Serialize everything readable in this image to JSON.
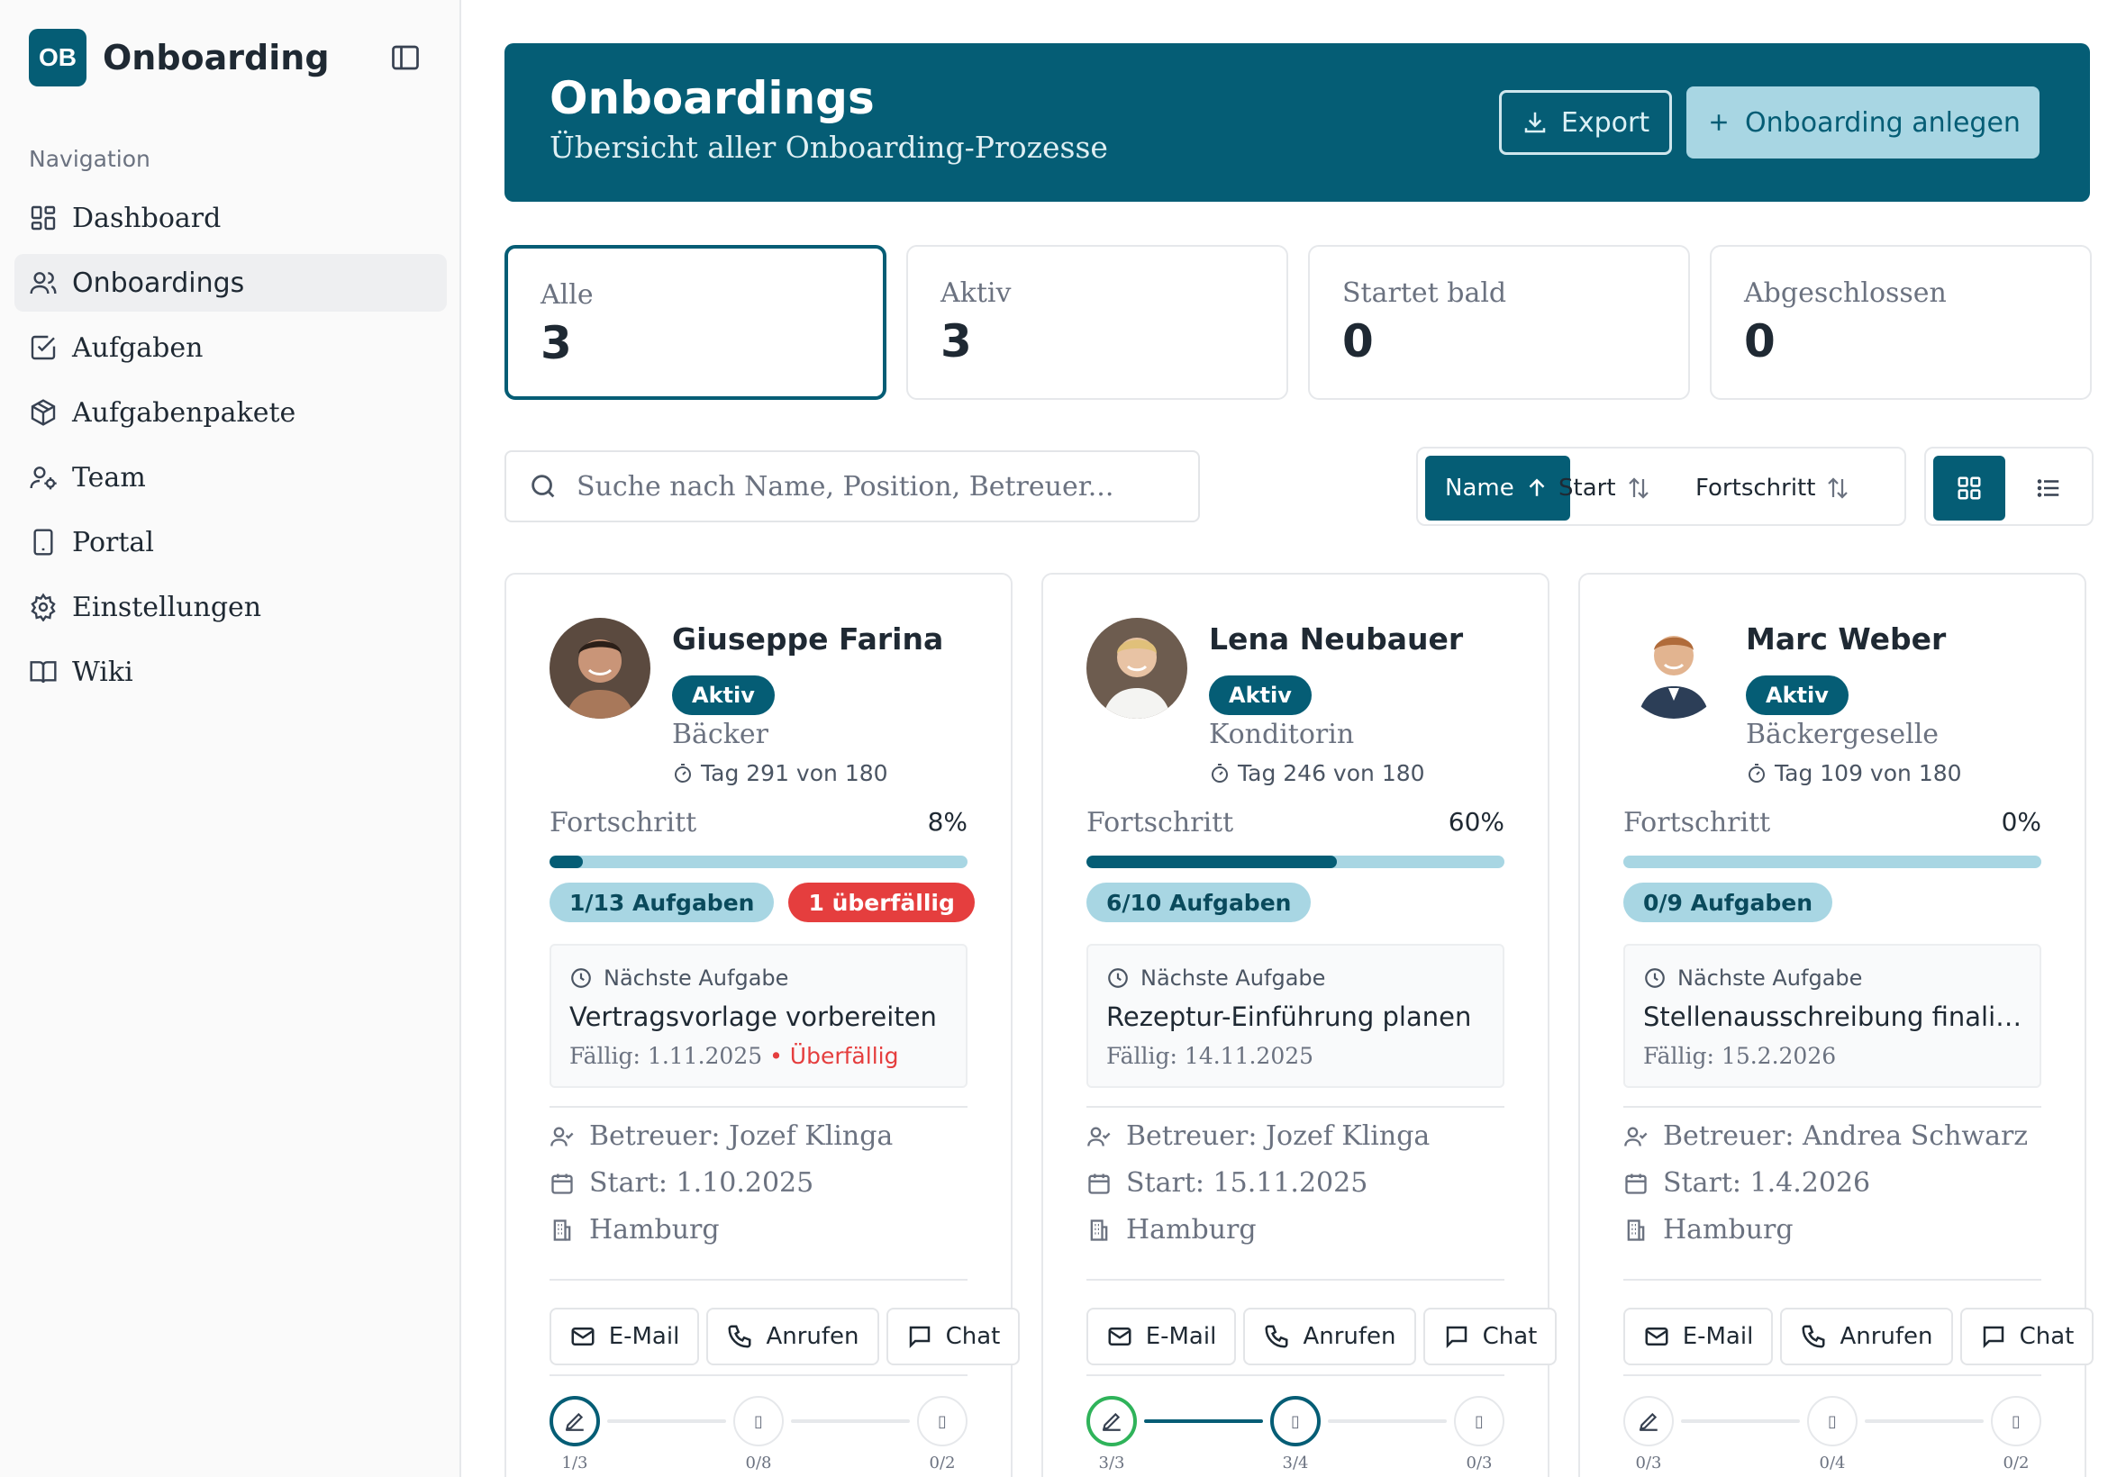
{
  "app": {
    "logo": "OB",
    "name": "Onboarding",
    "toggle_icon": "sidebar-toggle-icon"
  },
  "nav": {
    "caption": "Navigation",
    "items": [
      {
        "label": "Dashboard",
        "icon": "dashboard-icon"
      },
      {
        "label": "Onboardings",
        "icon": "users-icon"
      },
      {
        "label": "Aufgaben",
        "icon": "checkbox-icon"
      },
      {
        "label": "Aufgabenpakete",
        "icon": "package-icon"
      },
      {
        "label": "Team",
        "icon": "team-icon"
      },
      {
        "label": "Portal",
        "icon": "tablet-icon"
      },
      {
        "label": "Einstellungen",
        "icon": "gear-icon"
      },
      {
        "label": "Wiki",
        "icon": "book-icon"
      }
    ],
    "active": "Onboardings"
  },
  "header": {
    "title": "Onboardings",
    "subtitle": "Übersicht aller Onboarding-Prozesse",
    "export_label": "Export",
    "new_label": "Onboarding anlegen"
  },
  "stats": [
    {
      "label": "Alle",
      "value": "3"
    },
    {
      "label": "Aktiv",
      "value": "3"
    },
    {
      "label": "Startet bald",
      "value": "0"
    },
    {
      "label": "Abgeschlossen",
      "value": "0"
    }
  ],
  "search": {
    "placeholder": "Suche nach Name, Position, Betreuer...",
    "value": ""
  },
  "sort": {
    "name_label": "Name",
    "start_label": "Start",
    "progress_label": "Fortschritt",
    "active": "Name"
  },
  "view": {
    "active": "grid"
  },
  "colors": {
    "primary": "#055d75",
    "accent_light": "#a8d6e3",
    "danger": "#e53e3e",
    "success": "#2fb35a"
  },
  "cards": [
    {
      "name": "Giuseppe Farina",
      "status": "Aktiv",
      "role": "Bäcker",
      "day": "Tag 291 von 180",
      "progress_label": "Fortschritt",
      "progress_pct": "8%",
      "progress_value": 8,
      "tasks_chip": "1/13 Aufgaben",
      "overdue_chip": "1 überfällig",
      "next_caption": "Nächste Aufgabe",
      "next_title": "Vertragsvorlage vorbereiten",
      "next_due": "Fällig: 1.11.2025",
      "next_overdue": "• Überfällig",
      "mentor": "Betreuer: Jozef Klinga",
      "start": "Start: 1.10.2025",
      "location": "Hamburg",
      "email_label": "E-Mail",
      "call_label": "Anrufen",
      "chat_label": "Chat",
      "phases": [
        "1/3",
        "0/8",
        "0/2"
      ]
    },
    {
      "name": "Lena Neubauer",
      "status": "Aktiv",
      "role": "Konditorin",
      "day": "Tag 246 von 180",
      "progress_label": "Fortschritt",
      "progress_pct": "60%",
      "progress_value": 60,
      "tasks_chip": "6/10 Aufgaben",
      "next_caption": "Nächste Aufgabe",
      "next_title": "Rezeptur-Einführung planen",
      "next_due": "Fällig: 14.11.2025",
      "mentor": "Betreuer: Jozef Klinga",
      "start": "Start: 15.11.2025",
      "location": "Hamburg",
      "email_label": "E-Mail",
      "call_label": "Anrufen",
      "chat_label": "Chat",
      "phases": [
        "3/3",
        "3/4",
        "0/3"
      ]
    },
    {
      "name": "Marc Weber",
      "status": "Aktiv",
      "role": "Bäckergeselle",
      "day": "Tag 109 von 180",
      "progress_label": "Fortschritt",
      "progress_pct": "0%",
      "progress_value": 0,
      "tasks_chip": "0/9 Aufgaben",
      "next_caption": "Nächste Aufgabe",
      "next_title": "Stellenausschreibung finalisi...",
      "next_due": "Fällig: 15.2.2026",
      "mentor": "Betreuer: Andrea Schwarz",
      "start": "Start: 1.4.2026",
      "location": "Hamburg",
      "email_label": "E-Mail",
      "call_label": "Anrufen",
      "chat_label": "Chat",
      "phases": [
        "0/3",
        "0/4",
        "0/2"
      ]
    }
  ]
}
